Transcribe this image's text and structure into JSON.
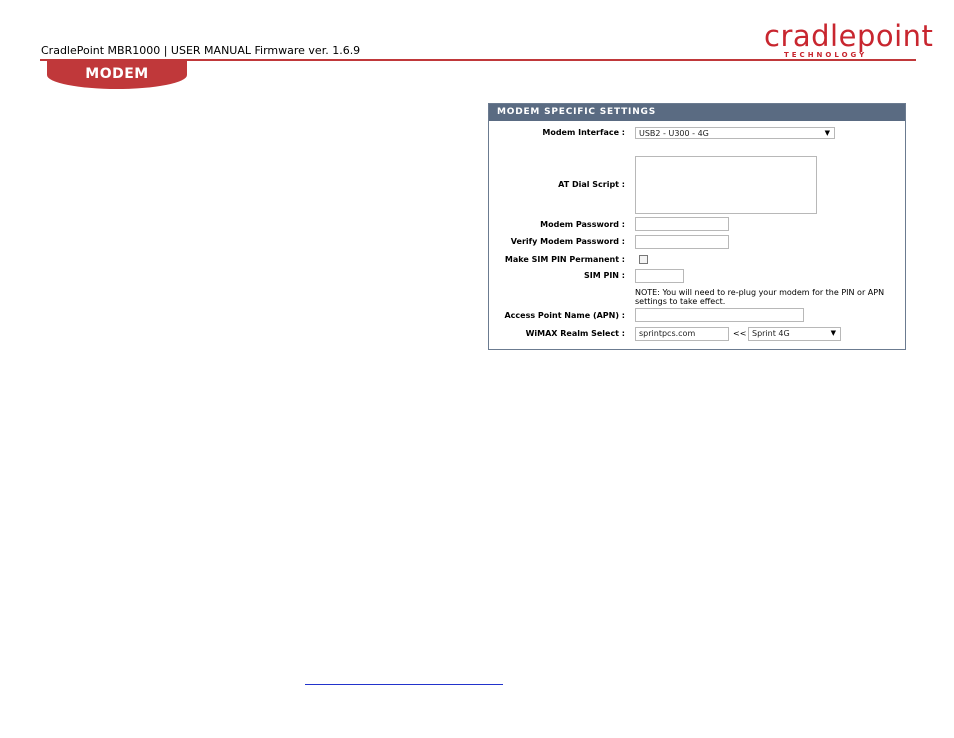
{
  "header": {
    "text": "CradlePoint MBR1000 | USER MANUAL Firmware ver. 1.6.9",
    "logo_word": "cradlepoint",
    "logo_sub": "TECHNOLOGY",
    "section_tab": "MODEM",
    "accent_color": "#c0383a"
  },
  "panel": {
    "title": "MODEM SPECIFIC SETTINGS",
    "modem_interface": {
      "label": "Modem Interface :",
      "value": "USB2 - U300 - 4G"
    },
    "at_dial_script": {
      "label": "AT Dial Script :",
      "value": ""
    },
    "modem_password": {
      "label": "Modem Password :",
      "value": ""
    },
    "verify_modem_password": {
      "label": "Verify Modem Password :",
      "value": ""
    },
    "sim_pin_permanent": {
      "label": "Make SIM PIN Permanent :",
      "checked": false
    },
    "sim_pin": {
      "label": "SIM PIN :",
      "value": ""
    },
    "note": "NOTE: You will need to re-plug your modem for the PIN or APN settings to take effect.",
    "apn": {
      "label": "Access Point Name (APN) :",
      "value": ""
    },
    "wimax_realm": {
      "label": "WiMAX Realm Select :",
      "value": "sprintpcs.com",
      "arrows": "<<",
      "select_value": "Sprint 4G"
    },
    "header_color": "#5a6b82"
  }
}
